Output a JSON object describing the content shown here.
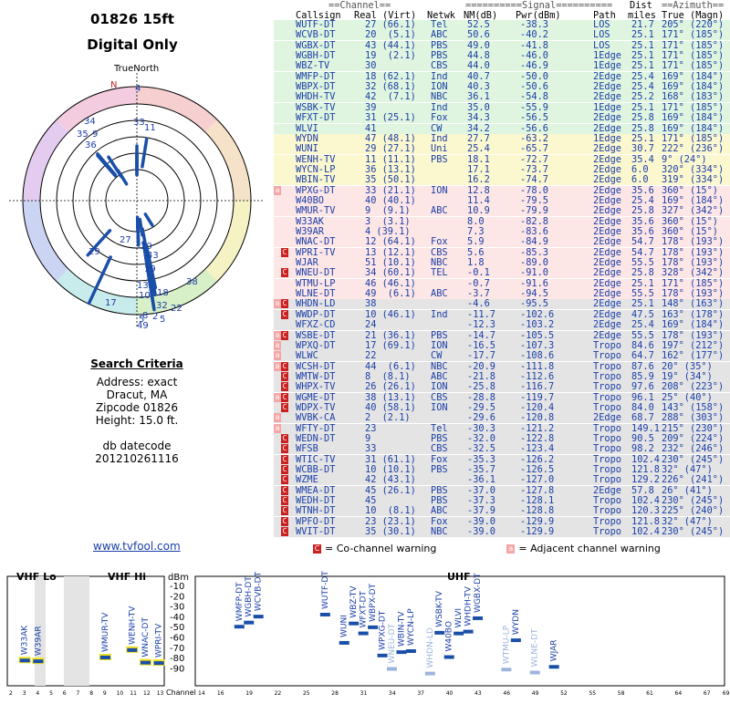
{
  "header": {
    "location": "01826 15ft",
    "mode": "Digital Only"
  },
  "polar": {
    "north_label": "TrueNorth",
    "n_letter": "N",
    "station_labels": [
      "4",
      "33",
      "11",
      "34",
      "35",
      "9",
      "36",
      "27",
      "20",
      "43",
      "19",
      "29",
      "13",
      "10",
      "18",
      "38",
      "17",
      "22",
      "32",
      "49",
      "2",
      "8",
      "5",
      "5"
    ]
  },
  "search": {
    "title": "Search Criteria",
    "lines": [
      "Address: exact",
      "Dracut, MA",
      "Zipcode 01826",
      "Height: 15.0 ft."
    ],
    "db_label": "db datecode",
    "db_value": "20121026111​6"
  },
  "footer_link": "www.tvfool.com",
  "table": {
    "group_headers": {
      "channel": "==Channel==",
      "signal": "==========Signal==========",
      "dist": "Dist",
      "azimuth": "==Azimuth=="
    },
    "columns": {
      "callsign": "Callsign",
      "real_virt": "Real (Virt)",
      "netwk": "Netwk",
      "nm": "NM(dB)",
      "pwr": "Pwr(dBm)",
      "path": "Path",
      "miles": "miles",
      "true_magn": "True (Magn)"
    },
    "rows": [
      {
        "cs": "WUTF-DT",
        "ch": "27 (66.1)",
        "net": "Tel",
        "nm": "52.5",
        "pwr": "-38.3",
        "path": "LOS",
        "mi": "21.7",
        "az": "205° (220°)",
        "band": "g",
        "w": ""
      },
      {
        "cs": "WCVB-DT",
        "ch": "20  (5.1)",
        "net": "ABC",
        "nm": "50.6",
        "pwr": "-40.2",
        "path": "LOS",
        "mi": "25.1",
        "az": "171° (185°)",
        "band": "g",
        "w": ""
      },
      {
        "cs": "WGBX-DT",
        "ch": "43 (44.1)",
        "net": "PBS",
        "nm": "49.0",
        "pwr": "-41.8",
        "path": "LOS",
        "mi": "25.1",
        "az": "171° (185°)",
        "band": "g",
        "w": ""
      },
      {
        "cs": "WGBH-DT",
        "ch": "19  (2.1)",
        "net": "PBS",
        "nm": "44.8",
        "pwr": "-46.0",
        "path": "1Edge",
        "mi": "25.1",
        "az": "171° (185°)",
        "band": "g",
        "w": ""
      },
      {
        "cs": "WBZ-TV",
        "ch": "30",
        "net": "CBS",
        "nm": "44.0",
        "pwr": "-46.9",
        "path": "1Edge",
        "mi": "25.1",
        "az": "171° (185°)",
        "band": "g",
        "w": ""
      },
      {
        "cs": "WMFP-DT",
        "ch": "18 (62.1)",
        "net": "Ind",
        "nm": "40.7",
        "pwr": "-50.0",
        "path": "2Edge",
        "mi": "25.4",
        "az": "169° (184°)",
        "band": "g",
        "w": ""
      },
      {
        "cs": "WBPX-DT",
        "ch": "32 (68.1)",
        "net": "ION",
        "nm": "40.3",
        "pwr": "-50.6",
        "path": "2Edge",
        "mi": "25.4",
        "az": "169° (184°)",
        "band": "g",
        "w": ""
      },
      {
        "cs": "WHDH-TV",
        "ch": "42  (7.1)",
        "net": "NBC",
        "nm": "36.1",
        "pwr": "-54.8",
        "path": "2Edge",
        "mi": "25.2",
        "az": "168° (183°)",
        "band": "g",
        "w": ""
      },
      {
        "cs": "WSBK-TV",
        "ch": "39",
        "net": "Ind",
        "nm": "35.0",
        "pwr": "-55.9",
        "path": "1Edge",
        "mi": "25.1",
        "az": "171° (185°)",
        "band": "g",
        "w": ""
      },
      {
        "cs": "WFXT-DT",
        "ch": "31 (25.1)",
        "net": "Fox",
        "nm": "34.3",
        "pwr": "-56.5",
        "path": "2Edge",
        "mi": "25.8",
        "az": "169° (184°)",
        "band": "g",
        "w": ""
      },
      {
        "cs": "WLVI",
        "ch": "41",
        "net": "CW",
        "nm": "34.2",
        "pwr": "-56.6",
        "path": "2Edge",
        "mi": "25.8",
        "az": "169° (184°)",
        "band": "g",
        "w": ""
      },
      {
        "cs": "WYDN",
        "ch": "47 (48.1)",
        "net": "Ind",
        "nm": "27.7",
        "pwr": "-63.2",
        "path": "1Edge",
        "mi": "25.1",
        "az": "171° (185°)",
        "band": "y",
        "w": ""
      },
      {
        "cs": "WUNI",
        "ch": "29 (27.1)",
        "net": "Uni",
        "nm": "25.4",
        "pwr": "-65.7",
        "path": "2Edge",
        "mi": "30.7",
        "az": "222° (236°)",
        "band": "y",
        "w": ""
      },
      {
        "cs": "WENH-TV",
        "ch": "11 (11.1)",
        "net": "PBS",
        "nm": "18.1",
        "pwr": "-72.7",
        "path": "2Edge",
        "mi": "35.4",
        "az": "9° (24°)",
        "band": "y",
        "w": ""
      },
      {
        "cs": "WYCN-LP",
        "ch": "36 (13.1)",
        "net": "",
        "nm": "17.1",
        "pwr": "-73.7",
        "path": "2Edge",
        "mi": "6.0",
        "az": "320° (334°)",
        "band": "y",
        "w": ""
      },
      {
        "cs": "WBIN-TV",
        "ch": "35 (50.1)",
        "net": "",
        "nm": "16.2",
        "pwr": "-74.7",
        "path": "2Edge",
        "mi": "6.0",
        "az": "319° (334°)",
        "band": "y",
        "w": ""
      },
      {
        "cs": "WPXG-DT",
        "ch": "33 (21.1)",
        "net": "ION",
        "nm": "12.8",
        "pwr": "-78.0",
        "path": "2Edge",
        "mi": "35.6",
        "az": "360° (15°)",
        "band": "r",
        "w": "a"
      },
      {
        "cs": "W40BO",
        "ch": "40 (40.1)",
        "net": "",
        "nm": "11.4",
        "pwr": "-79.5",
        "path": "2Edge",
        "mi": "25.4",
        "az": "169° (184°)",
        "band": "r",
        "w": ""
      },
      {
        "cs": "WMUR-TV",
        "ch": "9  (9.1)",
        "net": "ABC",
        "nm": "10.9",
        "pwr": "-79.9",
        "path": "2Edge",
        "mi": "25.8",
        "az": "327° (342°)",
        "band": "r",
        "w": ""
      },
      {
        "cs": "W33AK",
        "ch": "3  (3.1)",
        "net": "",
        "nm": "8.0",
        "pwr": "-82.8",
        "path": "2Edge",
        "mi": "35.6",
        "az": "360° (15°)",
        "band": "r",
        "w": ""
      },
      {
        "cs": "W39AR",
        "ch": "4 (39.1)",
        "net": "",
        "nm": "7.3",
        "pwr": "-83.6",
        "path": "2Edge",
        "mi": "35.6",
        "az": "360° (15°)",
        "band": "r",
        "w": ""
      },
      {
        "cs": "WNAC-DT",
        "ch": "12 (64.1)",
        "net": "Fox",
        "nm": "5.9",
        "pwr": "-84.9",
        "path": "2Edge",
        "mi": "54.7",
        "az": "178° (193°)",
        "band": "r",
        "w": ""
      },
      {
        "cs": "WPRI-TV",
        "ch": "13 (12.1)",
        "net": "CBS",
        "nm": "5.6",
        "pwr": "-85.3",
        "path": "2Edge",
        "mi": "54.7",
        "az": "178° (193°)",
        "band": "r",
        "w": "c"
      },
      {
        "cs": "WJAR",
        "ch": "51 (10.1)",
        "net": "NBC",
        "nm": "1.8",
        "pwr": "-89.0",
        "path": "2Edge",
        "mi": "55.5",
        "az": "178° (193°)",
        "band": "r",
        "w": ""
      },
      {
        "cs": "WNEU-DT",
        "ch": "34 (60.1)",
        "net": "TEL",
        "nm": "-0.1",
        "pwr": "-91.0",
        "path": "2Edge",
        "mi": "25.8",
        "az": "328° (342°)",
        "band": "r",
        "w": "c"
      },
      {
        "cs": "WTMU-LP",
        "ch": "46 (46.1)",
        "net": "",
        "nm": "-0.7",
        "pwr": "-91.6",
        "path": "2Edge",
        "mi": "25.1",
        "az": "171° (185°)",
        "band": "r",
        "w": ""
      },
      {
        "cs": "WLNE-DT",
        "ch": "49  (6.1)",
        "net": "ABC",
        "nm": "-3.7",
        "pwr": "-94.5",
        "path": "2Edge",
        "mi": "55.5",
        "az": "178° (193°)",
        "band": "r",
        "w": ""
      },
      {
        "cs": "WHDN-LD",
        "ch": "38",
        "net": "",
        "nm": "-4.6",
        "pwr": "-95.5",
        "path": "2Edge",
        "mi": "25.1",
        "az": "148° (163°)",
        "band": "x",
        "w": "ca"
      },
      {
        "cs": "WWDP-DT",
        "ch": "10 (46.1)",
        "net": "Ind",
        "nm": "-11.7",
        "pwr": "-102.6",
        "path": "2Edge",
        "mi": "47.5",
        "az": "163° (178°)",
        "band": "x",
        "w": "c"
      },
      {
        "cs": "WFXZ-CD",
        "ch": "24",
        "net": "",
        "nm": "-12.3",
        "pwr": "-103.2",
        "path": "2Edge",
        "mi": "25.4",
        "az": "169° (184°)",
        "band": "x",
        "w": ""
      },
      {
        "cs": "WSBE-DT",
        "ch": "21 (36.1)",
        "net": "PBS",
        "nm": "-14.7",
        "pwr": "-105.5",
        "path": "2Edge",
        "mi": "55.5",
        "az": "178° (193°)",
        "band": "x",
        "w": "ca"
      },
      {
        "cs": "WPXQ-DT",
        "ch": "17 (69.1)",
        "net": "ION",
        "nm": "-16.5",
        "pwr": "-107.3",
        "path": "Tropo",
        "mi": "84.6",
        "az": "197° (212°)",
        "band": "x",
        "w": "a"
      },
      {
        "cs": "WLWC",
        "ch": "22",
        "net": "CW",
        "nm": "-17.7",
        "pwr": "-108.6",
        "path": "Tropo",
        "mi": "64.7",
        "az": "162° (177°)",
        "band": "x",
        "w": "a"
      },
      {
        "cs": "WCSH-DT",
        "ch": "44  (6.1)",
        "net": "NBC",
        "nm": "-20.9",
        "pwr": "-111.8",
        "path": "Tropo",
        "mi": "87.6",
        "az": "20° (35°)",
        "band": "x",
        "w": "ca"
      },
      {
        "cs": "WMTW-DT",
        "ch": "8  (8.1)",
        "net": "ABC",
        "nm": "-21.8",
        "pwr": "-112.6",
        "path": "Tropo",
        "mi": "85.9",
        "az": "19° (34°)",
        "band": "x",
        "w": "c"
      },
      {
        "cs": "WHPX-TV",
        "ch": "26 (26.1)",
        "net": "ION",
        "nm": "-25.8",
        "pwr": "-116.7",
        "path": "Tropo",
        "mi": "97.6",
        "az": "208° (223°)",
        "band": "x",
        "w": "c"
      },
      {
        "cs": "WGME-DT",
        "ch": "38 (13.1)",
        "net": "CBS",
        "nm": "-28.8",
        "pwr": "-119.7",
        "path": "Tropo",
        "mi": "96.1",
        "az": "25° (40°)",
        "band": "x",
        "w": "ca"
      },
      {
        "cs": "WDPX-TV",
        "ch": "40 (58.1)",
        "net": "ION",
        "nm": "-29.5",
        "pwr": "-120.4",
        "path": "Tropo",
        "mi": "84.0",
        "az": "143° (158°)",
        "band": "x",
        "w": "c"
      },
      {
        "cs": "WVBK-CA",
        "ch": "2  (2.1)",
        "net": "",
        "nm": "-29.6",
        "pwr": "-120.8",
        "path": "2Edge",
        "mi": "68.7",
        "az": "288° (303°)",
        "band": "x",
        "w": "a"
      },
      {
        "cs": "WFTY-DT",
        "ch": "23",
        "net": "Tel",
        "nm": "-30.3",
        "pwr": "-121.2",
        "path": "Tropo",
        "mi": "149.1",
        "az": "215° (230°)",
        "band": "x",
        "w": "a"
      },
      {
        "cs": "WEDN-DT",
        "ch": "9",
        "net": "PBS",
        "nm": "-32.0",
        "pwr": "-122.8",
        "path": "Tropo",
        "mi": "90.5",
        "az": "209° (224°)",
        "band": "x",
        "w": "c"
      },
      {
        "cs": "WFSB",
        "ch": "33",
        "net": "CBS",
        "nm": "-32.5",
        "pwr": "-123.4",
        "path": "Tropo",
        "mi": "98.2",
        "az": "232° (246°)",
        "band": "x",
        "w": "c"
      },
      {
        "cs": "WTIC-TV",
        "ch": "31 (61.1)",
        "net": "Fox",
        "nm": "-35.3",
        "pwr": "-126.2",
        "path": "Tropo",
        "mi": "102.4",
        "az": "230° (245°)",
        "band": "x",
        "w": "c"
      },
      {
        "cs": "WCBB-DT",
        "ch": "10 (10.1)",
        "net": "PBS",
        "nm": "-35.7",
        "pwr": "-126.5",
        "path": "Tropo",
        "mi": "121.8",
        "az": "32° (47°)",
        "band": "x",
        "w": "c"
      },
      {
        "cs": "WZME",
        "ch": "42 (43.1)",
        "net": "",
        "nm": "-36.1",
        "pwr": "-127.0",
        "path": "Tropo",
        "mi": "129.2",
        "az": "226° (241°)",
        "band": "x",
        "w": "c"
      },
      {
        "cs": "WMEA-DT",
        "ch": "45 (26.1)",
        "net": "PBS",
        "nm": "-37.0",
        "pwr": "-127.8",
        "path": "2Edge",
        "mi": "57.8",
        "az": "26° (41°)",
        "band": "x",
        "w": "c"
      },
      {
        "cs": "WEDH-DT",
        "ch": "45",
        "net": "PBS",
        "nm": "-37.3",
        "pwr": "-128.1",
        "path": "Tropo",
        "mi": "102.4",
        "az": "230° (245°)",
        "band": "x",
        "w": "c"
      },
      {
        "cs": "WTNH-DT",
        "ch": "10  (8.1)",
        "net": "ABC",
        "nm": "-37.9",
        "pwr": "-128.8",
        "path": "Tropo",
        "mi": "120.3",
        "az": "225° (240°)",
        "band": "x",
        "w": "c"
      },
      {
        "cs": "WPFO-DT",
        "ch": "23 (23.1)",
        "net": "Fox",
        "nm": "-39.0",
        "pwr": "-129.9",
        "path": "Tropo",
        "mi": "121.8",
        "az": "32° (47°)",
        "band": "x",
        "w": "c"
      },
      {
        "cs": "WVIT-DT",
        "ch": "35 (30.1)",
        "net": "NBC",
        "nm": "-39.0",
        "pwr": "-129.9",
        "path": "Tropo",
        "mi": "102.4",
        "az": "230° (245°)",
        "band": "x",
        "w": "c"
      }
    ]
  },
  "legend": {
    "co_channel": "= Co-channel warning",
    "adjacent": "= Adjacent channel warning",
    "co_glyph": "C",
    "adj_glyph": "a"
  },
  "spectrum": {
    "vhf_lo": "VHF Lo",
    "vhf_hi": "VHF Hi",
    "uhf": "UHF",
    "unit": "dBm",
    "channel_label": "Channel",
    "y_ticks": [
      "-10",
      "-20",
      "-30",
      "-40",
      "-50",
      "-60",
      "-70",
      "-80",
      "-90"
    ],
    "vhf_ticks": [
      "2",
      "3",
      "4",
      "5",
      "6",
      "7",
      "8",
      "9",
      "10",
      "11",
      "12",
      "13"
    ],
    "uhf_ticks": [
      "14",
      "16",
      "19",
      "22",
      "25",
      "28",
      "31",
      "34",
      "37",
      "40",
      "43",
      "46",
      "49",
      "52",
      "55",
      "58",
      "61",
      "64",
      "67",
      "69"
    ],
    "bars": [
      {
        "label": "W33AK",
        "ch": 3,
        "pwr": -82.8,
        "band": "vhf"
      },
      {
        "label": "W39AR",
        "ch": 4,
        "pwr": -83.6,
        "band": "vhf"
      },
      {
        "label": "WMUR-TV",
        "ch": 9,
        "pwr": -79.9,
        "band": "vhf"
      },
      {
        "label": "WENH-TV",
        "ch": 11,
        "pwr": -72.7,
        "band": "vhf"
      },
      {
        "label": "WNAC-DT",
        "ch": 12,
        "pwr": -84.9,
        "band": "vhf"
      },
      {
        "label": "WPRI-TV",
        "ch": 13,
        "pwr": -85.3,
        "band": "vhf"
      },
      {
        "label": "WMFP-DT",
        "ch": 18,
        "pwr": -50.0,
        "band": "uhf"
      },
      {
        "label": "WGBH-DT",
        "ch": 19,
        "pwr": -46.0,
        "band": "uhf"
      },
      {
        "label": "WCVB-DT",
        "ch": 20,
        "pwr": -40.2,
        "band": "uhf"
      },
      {
        "label": "WUTF-DT",
        "ch": 27,
        "pwr": -38.3,
        "band": "uhf"
      },
      {
        "label": "WUNI",
        "ch": 29,
        "pwr": -65.7,
        "band": "uhf"
      },
      {
        "label": "WBZ-TV",
        "ch": 30,
        "pwr": -46.9,
        "band": "uhf"
      },
      {
        "label": "WFXT-DT",
        "ch": 31,
        "pwr": -56.5,
        "band": "uhf"
      },
      {
        "label": "WBPX-DT",
        "ch": 32,
        "pwr": -50.6,
        "band": "uhf"
      },
      {
        "label": "WPXG-DT",
        "ch": 33,
        "pwr": -78.0,
        "band": "uhf"
      },
      {
        "label": "WNEU-DT",
        "ch": 34,
        "pwr": -91.0,
        "band": "uhf"
      },
      {
        "label": "WBIN-TV",
        "ch": 35,
        "pwr": -74.7,
        "band": "uhf"
      },
      {
        "label": "WYCN-LP",
        "ch": 36,
        "pwr": -73.7,
        "band": "uhf"
      },
      {
        "label": "WHDN-LD",
        "ch": 38,
        "pwr": -95.5,
        "band": "uhf"
      },
      {
        "label": "WSBK-TV",
        "ch": 39,
        "pwr": -55.9,
        "band": "uhf"
      },
      {
        "label": "W40BO",
        "ch": 40,
        "pwr": -79.5,
        "band": "uhf"
      },
      {
        "label": "WLVI",
        "ch": 41,
        "pwr": -56.6,
        "band": "uhf"
      },
      {
        "label": "WHDH-TV",
        "ch": 42,
        "pwr": -54.8,
        "band": "uhf"
      },
      {
        "label": "WGBX-DT",
        "ch": 43,
        "pwr": -41.8,
        "band": "uhf"
      },
      {
        "label": "WTMU-LP",
        "ch": 46,
        "pwr": -91.6,
        "band": "uhf"
      },
      {
        "label": "WYDN",
        "ch": 47,
        "pwr": -63.2,
        "band": "uhf"
      },
      {
        "label": "WLNE-DT",
        "ch": 49,
        "pwr": -94.5,
        "band": "uhf"
      },
      {
        "label": "WJAR",
        "ch": 51,
        "pwr": -89.0,
        "band": "uhf"
      }
    ]
  },
  "colors": {
    "band_g": "#dff5df",
    "band_y": "#fbf7cf",
    "band_r": "#fde6e6",
    "band_x": "#e4e4e4",
    "text_blue": "#1a3ea8",
    "bar": "#1a4fa8",
    "warn": "#cc2020"
  }
}
